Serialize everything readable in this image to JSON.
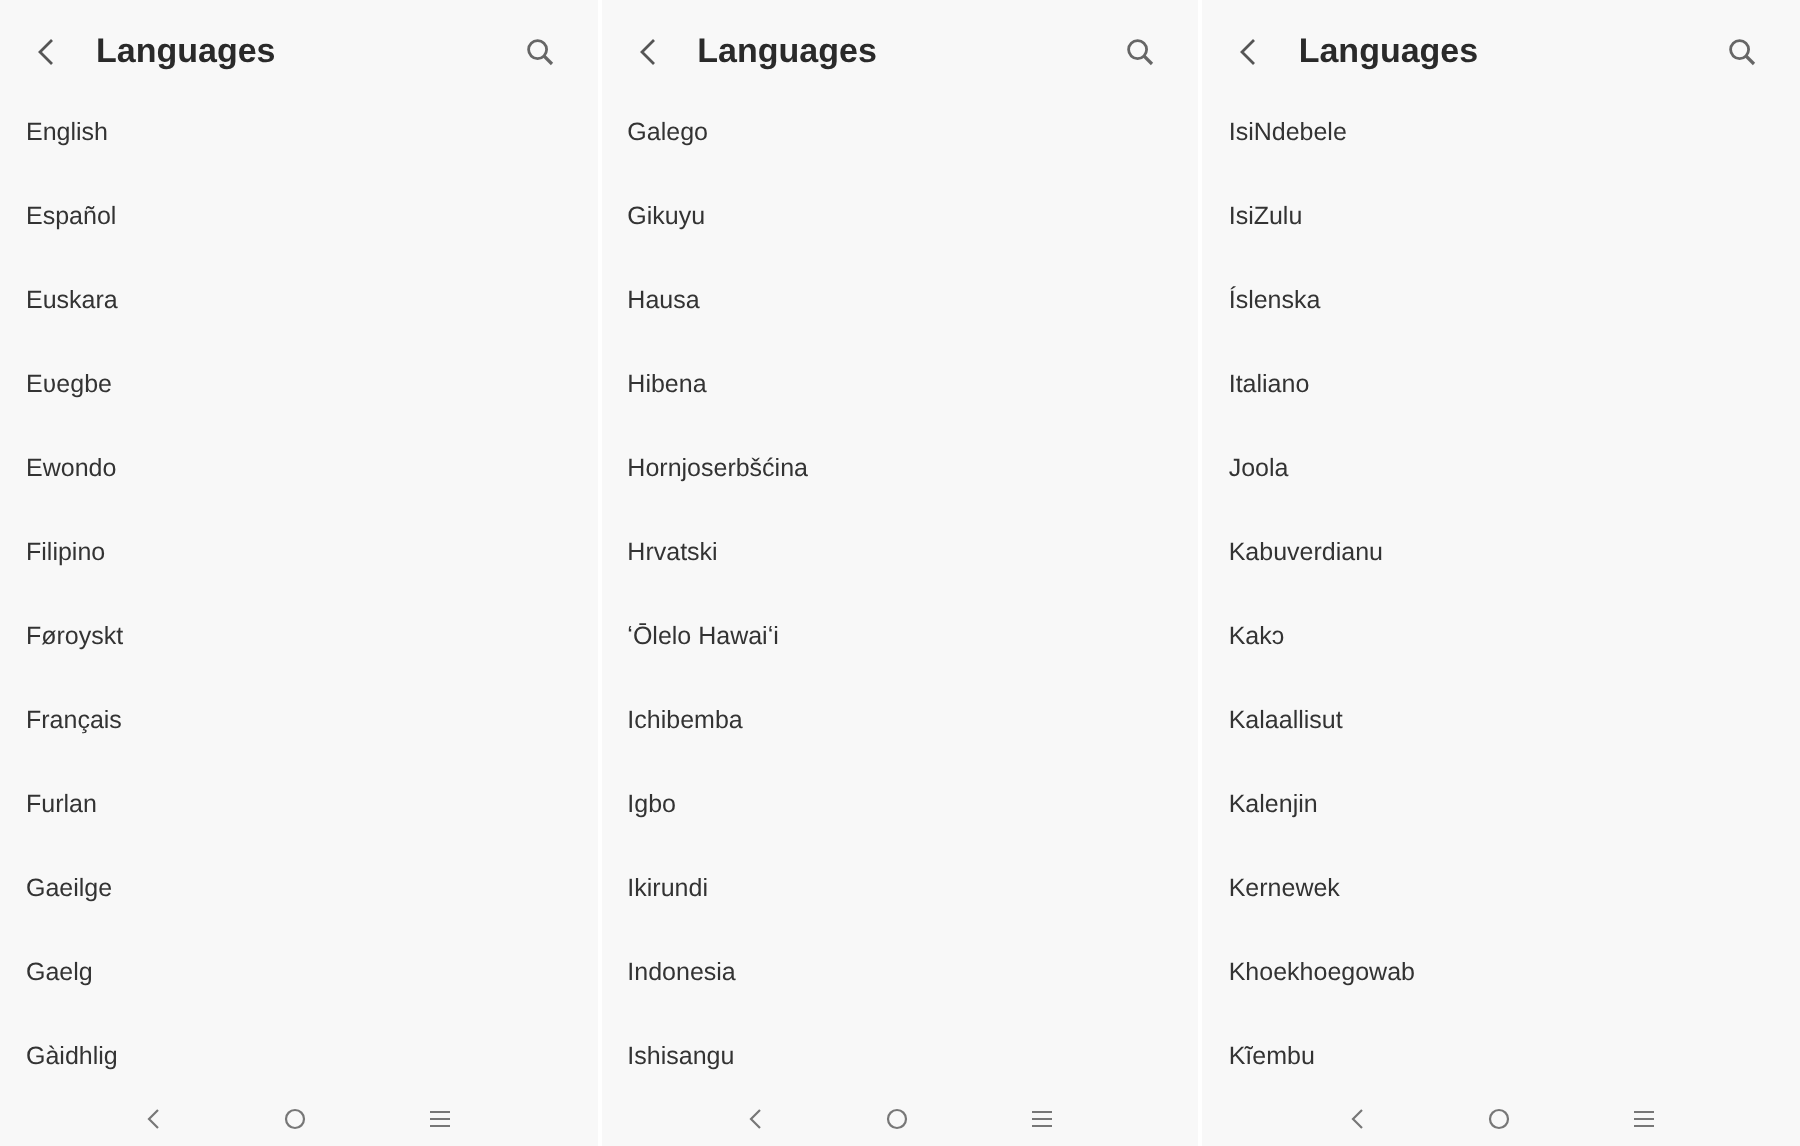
{
  "screens": [
    {
      "title": "Languages",
      "items": [
        "English",
        "Español",
        "Euskara",
        "Eʋegbe",
        "Ewondo",
        "Filipino",
        "Føroyskt",
        "Français",
        "Furlan",
        "Gaeilge",
        "Gaelg",
        "Gàidhlig"
      ]
    },
    {
      "title": "Languages",
      "items": [
        "Galego",
        "Gikuyu",
        "Hausa",
        "Hibena",
        "Hornjoserbšćina",
        "Hrvatski",
        "ʻŌlelo Hawaiʻi",
        "Ichibemba",
        "Igbo",
        "Ikirundi",
        "Indonesia",
        "Ishisangu"
      ]
    },
    {
      "title": "Languages",
      "items": [
        "IsiNdebele",
        "IsiZulu",
        "Íslenska",
        "Italiano",
        "Joola",
        "Kabuverdianu",
        "Kakɔ",
        "Kalaallisut",
        "Kalenjin",
        "Kernewek",
        "Khoekhoegowab",
        "Kĩembu"
      ]
    }
  ]
}
